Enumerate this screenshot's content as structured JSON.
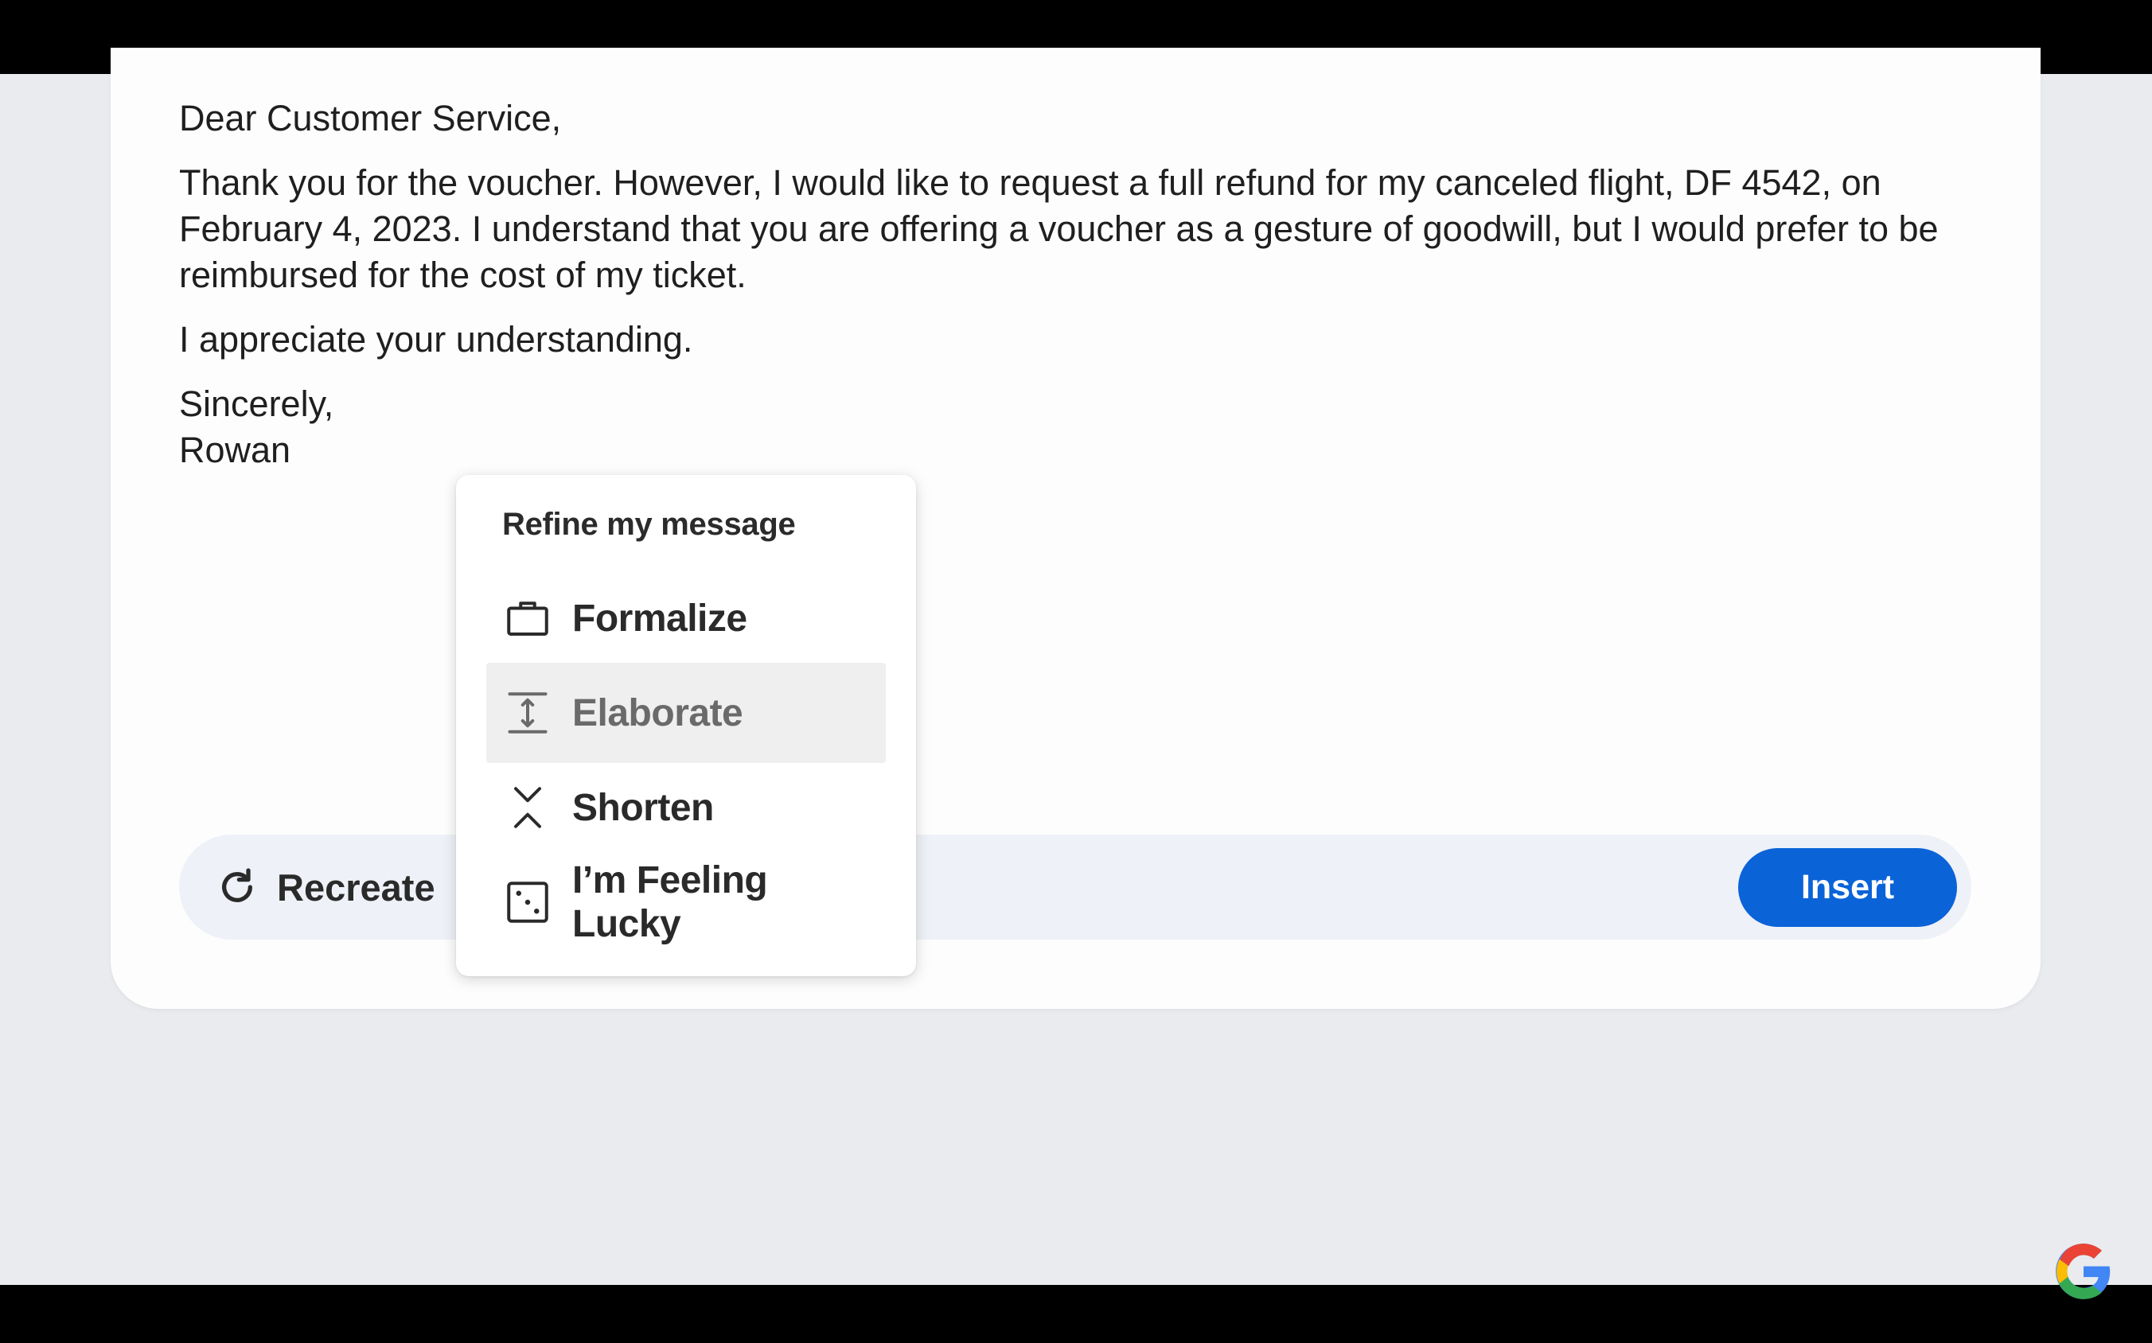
{
  "email": {
    "greeting": "Dear Customer Service,",
    "paragraph1": "Thank you for the voucher. However, I would like to request a full refund for my canceled flight, DF 4542, on February 4, 2023. I understand that you are offering a voucher as a gesture of goodwill, but I would prefer to be reimbursed for the cost of my ticket.",
    "paragraph2": "I appreciate your understanding.",
    "closing": "Sincerely,",
    "signature": "Rowan"
  },
  "action_bar": {
    "recreate_label": "Recreate",
    "insert_label": "Insert"
  },
  "refine_menu": {
    "title": "Refine my message",
    "items": [
      {
        "label": "Formalize",
        "icon": "briefcase-icon"
      },
      {
        "label": "Elaborate",
        "icon": "expand-vertical-icon",
        "hovered": true
      },
      {
        "label": "Shorten",
        "icon": "collapse-vertical-icon"
      },
      {
        "label": "I’m Feeling Lucky",
        "icon": "dice-icon"
      }
    ]
  },
  "branding": {
    "logo": "google-g-logo"
  },
  "colors": {
    "insert_button": "#0b63d8",
    "action_bar_bg": "#eef1f7",
    "page_bg": "#e9ebee",
    "hover_bg": "#efefef"
  }
}
